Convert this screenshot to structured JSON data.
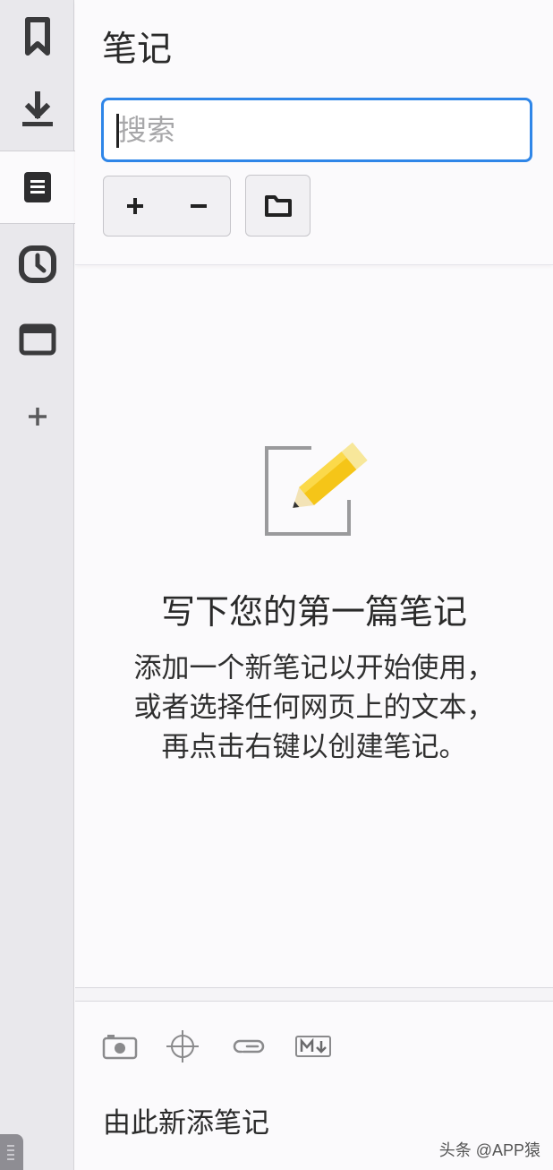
{
  "sidebar": {
    "items": [
      {
        "icon": "bookmark-icon",
        "active": false
      },
      {
        "icon": "download-icon",
        "active": false
      },
      {
        "icon": "notes-icon",
        "active": true
      },
      {
        "icon": "history-icon",
        "active": false
      },
      {
        "icon": "window-icon",
        "active": false
      },
      {
        "icon": "plus-icon",
        "active": false
      }
    ]
  },
  "panel": {
    "title": "笔记",
    "search": {
      "value": "",
      "placeholder": "搜索"
    },
    "buttons": {
      "add": "+",
      "remove": "−",
      "folder": "folder-icon"
    }
  },
  "empty_state": {
    "icon": "pencil-note-icon",
    "title": "写下您的第一篇笔记",
    "description": "添加一个新笔记以开始使用，或者选择任何网页上的文本， 再点击右键以创建笔记。"
  },
  "footer": {
    "tools": [
      "camera-icon",
      "crosshair-icon",
      "paperclip-icon",
      "markdown-icon"
    ],
    "placeholder": "由此新添笔记"
  },
  "watermark": "头条 @APP猿",
  "colors": {
    "accent": "#2f86e8",
    "sidebar_bg": "#e9e8ec",
    "pencil": "#f5c518"
  }
}
